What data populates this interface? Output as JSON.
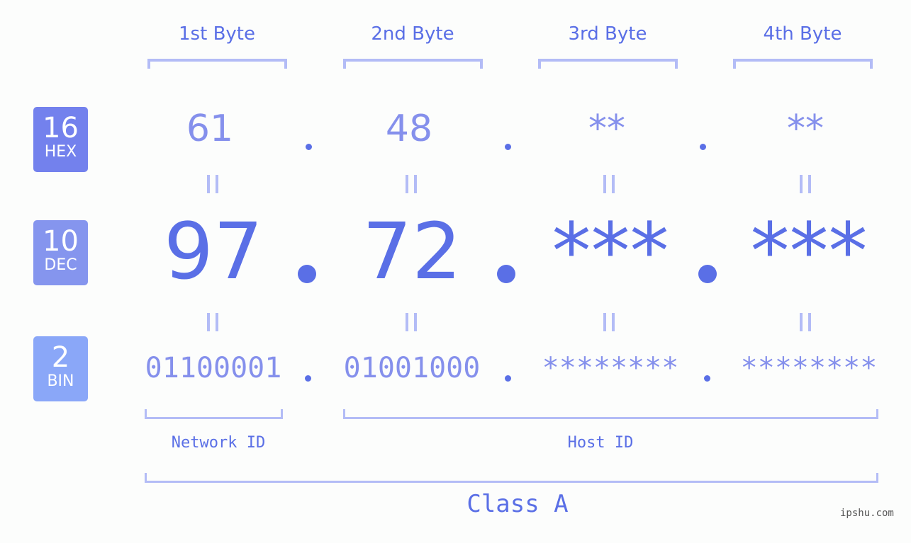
{
  "headers": [
    "1st Byte",
    "2nd Byte",
    "3rd Byte",
    "4th Byte"
  ],
  "bases": {
    "hex": {
      "num": "16",
      "label": "HEX",
      "color": "#7381ed"
    },
    "dec": {
      "num": "10",
      "label": "DEC",
      "color": "#8595ee"
    },
    "bin": {
      "num": "2",
      "label": "BIN",
      "color": "#8aa7f8"
    }
  },
  "hex_values": [
    "61",
    "48",
    "**",
    "**"
  ],
  "dec_values": [
    "97",
    "72",
    "***",
    "***"
  ],
  "bin_values": [
    "01100001",
    "01001000",
    "********",
    "********"
  ],
  "labels": {
    "network_id": "Network ID",
    "host_id": "Host ID",
    "class": "Class A"
  },
  "watermark": "ipshu.com",
  "colors": {
    "accent": "#5a6fe6",
    "light": "#8590ec",
    "bracket": "#b3bcf6"
  }
}
